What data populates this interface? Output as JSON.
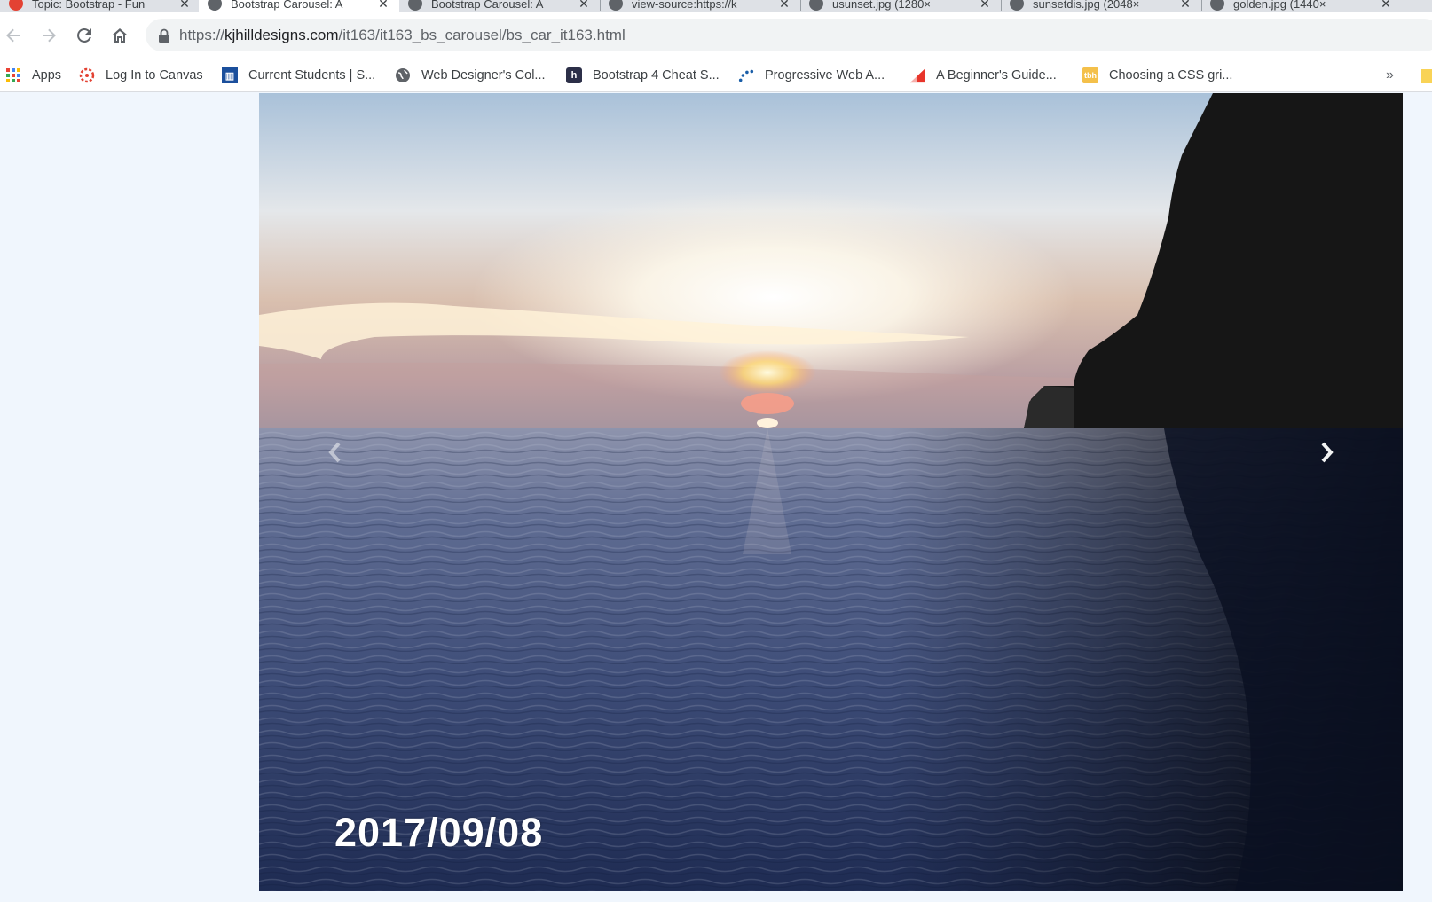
{
  "browser": {
    "tabs": [
      {
        "title": "Topic: Bootstrap - Fun",
        "favicon": "canvas-icon",
        "active": false
      },
      {
        "title": "Bootstrap Carousel: A",
        "favicon": "globe-icon",
        "active": true
      },
      {
        "title": "Bootstrap Carousel: A",
        "favicon": "globe-icon",
        "active": false
      },
      {
        "title": "view-source:https://k",
        "favicon": "globe-icon",
        "active": false
      },
      {
        "title": "usunset.jpg (1280×",
        "favicon": "globe-icon",
        "active": false
      },
      {
        "title": "sunsetdis.jpg (2048×",
        "favicon": "globe-icon",
        "active": false
      },
      {
        "title": "golden.jpg (1440×",
        "favicon": "globe-icon",
        "active": false
      }
    ],
    "address": {
      "scheme": "https://",
      "host": "kjhilldesigns.com",
      "path": "/it163/it163_bs_carousel/bs_car_it163.html"
    },
    "bookmarks": [
      {
        "label": "Apps",
        "icon": "apps-grid-icon"
      },
      {
        "label": "Log In to Canvas",
        "icon": "canvas-icon"
      },
      {
        "label": "Current Students | S...",
        "icon": "college-icon"
      },
      {
        "label": "Web Designer's Col...",
        "icon": "globe-icon"
      },
      {
        "label": "Bootstrap 4 Cheat S...",
        "icon": "h-badge-icon"
      },
      {
        "label": "Progressive Web A...",
        "icon": "dots-icon"
      },
      {
        "label": "A Beginner's Guide...",
        "icon": "red-flag-icon"
      },
      {
        "label": "Choosing a CSS gri...",
        "icon": "tbh-icon"
      }
    ],
    "overflow_label": "»"
  },
  "carousel": {
    "caption_date": "2017/09/08",
    "prev_icon": "chevron-left-icon",
    "next_icon": "chevron-right-icon"
  }
}
